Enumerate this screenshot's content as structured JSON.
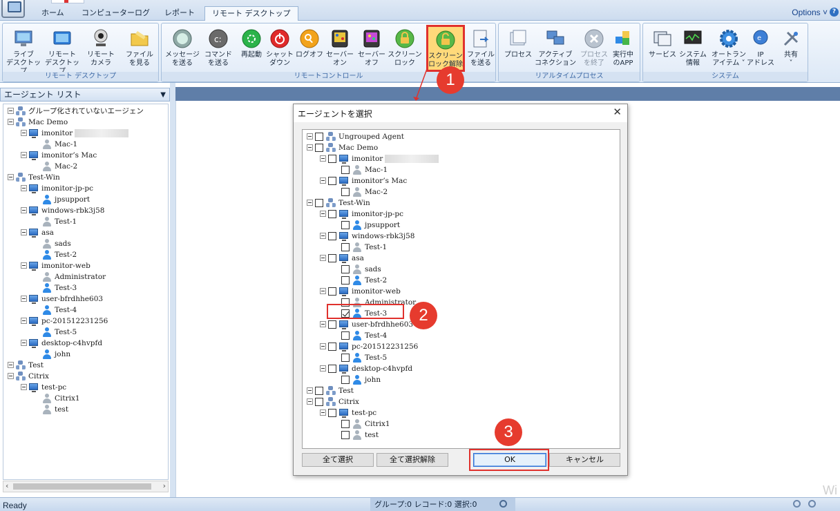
{
  "tabs": [
    "ホーム",
    "コンピューターログ",
    "レポート",
    "リモート デスクトップ"
  ],
  "active_tab": "リモート デスクトップ",
  "options_label": "Options ˅",
  "help_label": "?",
  "groups": [
    {
      "label": "リモート デスクトップ",
      "buttons": [
        {
          "icon": "monitor-icon",
          "label": "ライブ\nデスクトップ"
        },
        {
          "icon": "remote-desktop-icon",
          "label": "リモート\nデスクトップ"
        },
        {
          "icon": "webcam-icon",
          "label": "リモート\nカメラ"
        },
        {
          "icon": "folder-icon",
          "label": "ファイル\nを見る"
        }
      ]
    },
    {
      "label": "リモートコントロール",
      "buttons": [
        {
          "icon": "message-icon",
          "label": "メッセージ\nを送る"
        },
        {
          "icon": "command-icon",
          "label": "コマンド\nを送る"
        },
        {
          "icon": "restart-icon",
          "label": "再起動"
        },
        {
          "icon": "shutdown-icon",
          "label": "シャット\nダウン"
        },
        {
          "icon": "logoff-icon",
          "label": "ログオフ"
        },
        {
          "icon": "saver-on-icon",
          "label": "セーバー\nオン"
        },
        {
          "icon": "saver-off-icon",
          "label": "セーバー\nオフ"
        },
        {
          "icon": "screen-lock-icon",
          "label": "スクリーン\nロック"
        },
        {
          "icon": "screen-unlock-icon",
          "label": "スクリーン\nロック解除"
        },
        {
          "icon": "send-file-icon",
          "label": "ファイル\nを送る"
        }
      ]
    },
    {
      "label": "リアルタイムプロセス",
      "buttons": [
        {
          "icon": "process-icon",
          "label": "プロセス"
        },
        {
          "icon": "connection-icon",
          "label": "アクティブ\nコネクション"
        },
        {
          "icon": "end-process-icon",
          "label": "プロセス\nを終了"
        },
        {
          "icon": "running-app-icon",
          "label": "実行中\nのAPP"
        }
      ]
    },
    {
      "label": "システム",
      "buttons": [
        {
          "icon": "services-icon",
          "label": "サービス"
        },
        {
          "icon": "system-info-icon",
          "label": "システム\n情報"
        },
        {
          "icon": "autorun-icon",
          "label": "オートラン\nアイテム ˅"
        },
        {
          "icon": "ip-address-icon",
          "label": "IP\nアドレス"
        },
        {
          "icon": "share-icon",
          "label": "共有\n˅"
        }
      ]
    }
  ],
  "left_panel": {
    "title": "エージェント リスト"
  },
  "agent_tree": [
    {
      "type": "group",
      "label": "グループ化されていないエージェン",
      "level": 0
    },
    {
      "type": "group",
      "label": "Mac Demo",
      "level": 0
    },
    {
      "type": "pc",
      "label": "imonitor",
      "level": 1,
      "blurred": true
    },
    {
      "type": "user-off",
      "label": "Mac-1",
      "level": 2
    },
    {
      "type": "pc",
      "label": "imonitor’s Mac",
      "level": 1
    },
    {
      "type": "user-off",
      "label": "Mac-2",
      "level": 2
    },
    {
      "type": "group",
      "label": "Test-Win",
      "level": 0
    },
    {
      "type": "pc",
      "label": "imonitor-jp-pc",
      "level": 1
    },
    {
      "type": "user",
      "label": "jpsupport",
      "level": 2
    },
    {
      "type": "pc",
      "label": "windows-rbk3j58",
      "level": 1
    },
    {
      "type": "user-off",
      "label": "Test-1",
      "level": 2
    },
    {
      "type": "pc",
      "label": "asa",
      "level": 1
    },
    {
      "type": "user-off",
      "label": "sads",
      "level": 2
    },
    {
      "type": "user",
      "label": "Test-2",
      "level": 2
    },
    {
      "type": "pc",
      "label": "imonitor-web",
      "level": 1
    },
    {
      "type": "user-off",
      "label": "Administrator",
      "level": 2
    },
    {
      "type": "user",
      "label": "Test-3",
      "level": 2
    },
    {
      "type": "pc",
      "label": "user-bfrdhhe603",
      "level": 1
    },
    {
      "type": "user",
      "label": "Test-4",
      "level": 2
    },
    {
      "type": "pc",
      "label": "pc-201512231256",
      "level": 1
    },
    {
      "type": "user",
      "label": "Test-5",
      "level": 2
    },
    {
      "type": "pc",
      "label": "desktop-c4hvpfd",
      "level": 1
    },
    {
      "type": "user",
      "label": "john",
      "level": 2
    },
    {
      "type": "group",
      "label": "Test",
      "level": 0
    },
    {
      "type": "group",
      "label": "Citrix",
      "level": 0
    },
    {
      "type": "pc",
      "label": "test-pc",
      "level": 1
    },
    {
      "type": "user-off",
      "label": "Citrix1",
      "level": 2
    },
    {
      "type": "user-off",
      "label": "test",
      "level": 2
    }
  ],
  "dialog": {
    "title": "エージェントを選択",
    "close": "✕",
    "tree": [
      {
        "type": "group",
        "label": "Ungrouped Agent",
        "level": 0,
        "checked": false
      },
      {
        "type": "group",
        "label": "Mac Demo",
        "level": 0,
        "checked": false
      },
      {
        "type": "pc",
        "label": "imonitor",
        "level": 1,
        "checked": false,
        "blurred": true
      },
      {
        "type": "user-off",
        "label": "Mac-1",
        "level": 2,
        "checked": false
      },
      {
        "type": "pc",
        "label": "imonitor’s Mac",
        "level": 1,
        "checked": false
      },
      {
        "type": "user-off",
        "label": "Mac-2",
        "level": 2,
        "checked": false
      },
      {
        "type": "group",
        "label": "Test-Win",
        "level": 0,
        "checked": false
      },
      {
        "type": "pc",
        "label": "imonitor-jp-pc",
        "level": 1,
        "checked": false
      },
      {
        "type": "user",
        "label": "jpsupport",
        "level": 2,
        "checked": false
      },
      {
        "type": "pc",
        "label": "windows-rbk3j58",
        "level": 1,
        "checked": false
      },
      {
        "type": "user-off",
        "label": "Test-1",
        "level": 2,
        "checked": false
      },
      {
        "type": "pc",
        "label": "asa",
        "level": 1,
        "checked": false
      },
      {
        "type": "user-off",
        "label": "sads",
        "level": 2,
        "checked": false
      },
      {
        "type": "user",
        "label": "Test-2",
        "level": 2,
        "checked": false
      },
      {
        "type": "pc",
        "label": "imonitor-web",
        "level": 1,
        "checked": false
      },
      {
        "type": "user-off",
        "label": "Administrator",
        "level": 2,
        "checked": false
      },
      {
        "type": "user",
        "label": "Test-3",
        "level": 2,
        "checked": true
      },
      {
        "type": "pc",
        "label": "user-bfrdhhe603",
        "level": 1,
        "checked": false
      },
      {
        "type": "user",
        "label": "Test-4",
        "level": 2,
        "checked": false
      },
      {
        "type": "pc",
        "label": "pc-201512231256",
        "level": 1,
        "checked": false
      },
      {
        "type": "user",
        "label": "Test-5",
        "level": 2,
        "checked": false
      },
      {
        "type": "pc",
        "label": "desktop-c4hvpfd",
        "level": 1,
        "checked": false
      },
      {
        "type": "user",
        "label": "john",
        "level": 2,
        "checked": false
      },
      {
        "type": "group",
        "label": "Test",
        "level": 0,
        "checked": false
      },
      {
        "type": "group",
        "label": "Citrix",
        "level": 0,
        "checked": false
      },
      {
        "type": "pc",
        "label": "test-pc",
        "level": 1,
        "checked": false
      },
      {
        "type": "user-off",
        "label": "Citrix1",
        "level": 2,
        "checked": false
      },
      {
        "type": "user-off",
        "label": "test",
        "level": 2,
        "checked": false
      }
    ],
    "buttons": {
      "select_all": "全て選択",
      "deselect_all": "全て選択解除",
      "ok": "OK",
      "cancel": "キャンセル"
    }
  },
  "annotations": [
    "1",
    "2",
    "3"
  ],
  "status": {
    "left": "Ready",
    "middle": "グループ:0 レコード:0 選択:0"
  },
  "watermark": "Wi",
  "colors": {
    "ribbon_blue": "#dce8f6",
    "highlight_red": "#e0312d",
    "annotation_red": "#e63b2e",
    "main_bar": "#5f7ea8"
  }
}
